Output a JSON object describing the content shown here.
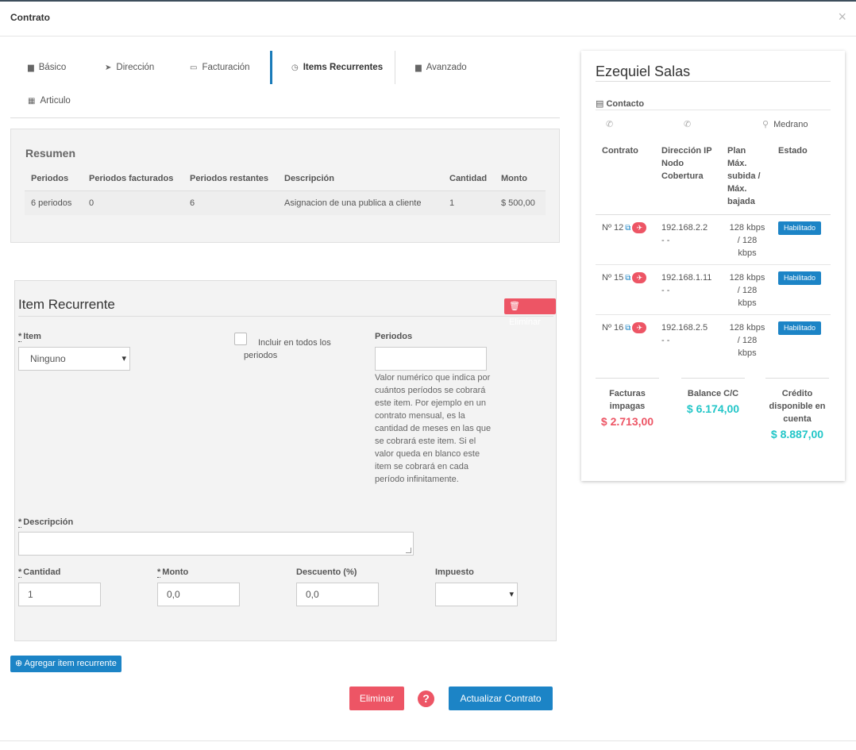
{
  "modal": {
    "title": "Contrato",
    "close": "×"
  },
  "tabs": [
    {
      "label": "Básico",
      "icon": "briefcase-icon"
    },
    {
      "label": "Dirección",
      "icon": "location-arrow-icon"
    },
    {
      "label": "Facturación",
      "icon": "money-icon"
    },
    {
      "label": "Items Recurrentes",
      "icon": "clock-icon",
      "active": true
    },
    {
      "label": "Avanzado",
      "icon": "briefcase-icon"
    },
    {
      "label": "Articulo",
      "icon": "grid-icon"
    }
  ],
  "resumen": {
    "title": "Resumen",
    "headers": [
      "Periodos",
      "Periodos facturados",
      "Periodos restantes",
      "Descripción",
      "Cantidad",
      "Monto"
    ],
    "rows": [
      [
        "6 periodos",
        "0",
        "6",
        "Asignacion de una publica a cliente",
        "1",
        "$ 500,00"
      ]
    ]
  },
  "item_form": {
    "title": "Item Recurrente",
    "delete_label": "Eliminar",
    "item_label": "Item",
    "item_value": "Ninguno",
    "include_all_label": "Incluir en todos los periodos",
    "periodos_label": "Periodos",
    "periodos_value": "",
    "periodos_help": "Valor numérico que indica por cuántos períodos se cobrará este item. Por ejemplo en un contrato mensual, es la cantidad de meses en las que se cobrará este item. Si el valor queda en blanco este item se cobrará en cada período infinitamente.",
    "descripcion_label": "Descripción",
    "descripcion_value": "",
    "cantidad_label": "Cantidad",
    "cantidad_value": "1",
    "monto_label": "Monto",
    "monto_value": "0,0",
    "descuento_label": "Descuento (%)",
    "descuento_value": "0,0",
    "impuesto_label": "Impuesto",
    "impuesto_value": "",
    "required_mark": "*"
  },
  "actions": {
    "add_item": "Agregar item recurrente",
    "delete": "Eliminar",
    "help": "?",
    "update": "Actualizar Contrato"
  },
  "client": {
    "name": "Ezequiel Salas",
    "contact_label": "Contacto",
    "location": "Medrano",
    "table_headers": [
      "Contrato",
      "Dirección IP Nodo Cobertura",
      "Plan Máx. subida / Máx. bajada",
      "Estado"
    ],
    "contracts": [
      {
        "number": "Nº 12",
        "ip": "192.168.2.2",
        "node": "- -",
        "plan": "128 kbps / 128 kbps",
        "status": "Habilitado"
      },
      {
        "number": "Nº 15",
        "ip": "192.168.1.11",
        "node": "- -",
        "plan": "128 kbps / 128 kbps",
        "status": "Habilitado"
      },
      {
        "number": "Nº 16",
        "ip": "192.168.2.5",
        "node": "- -",
        "plan": "128 kbps / 128 kbps",
        "status": "Habilitado"
      }
    ],
    "stats": [
      {
        "label": "Facturas impagas",
        "value": "$ 2.713,00",
        "color": "#ed5565"
      },
      {
        "label": "Balance C/C",
        "value": "$ 6.174,00",
        "color": "#23c6c8"
      },
      {
        "label": "Crédito disponible en cuenta",
        "value": "$ 8.887,00",
        "color": "#23c6c8"
      }
    ]
  },
  "colors": {
    "primary": "#1c84c6",
    "danger": "#ed5565",
    "info": "#23c6c8"
  }
}
